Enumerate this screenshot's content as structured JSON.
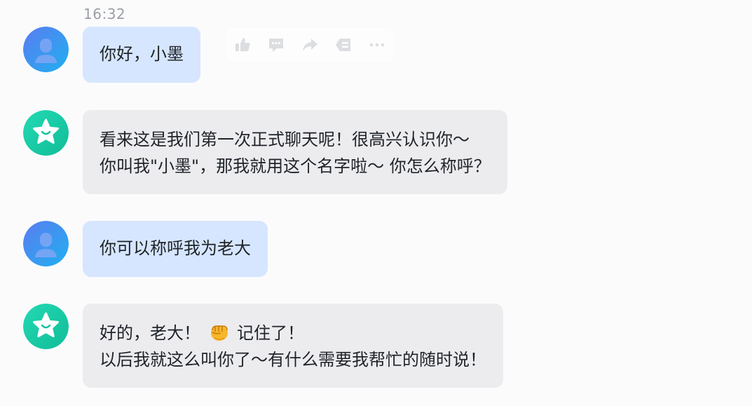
{
  "timestamp": "16:32",
  "colors": {
    "user_bubble": "#d6e6fe",
    "bot_bubble": "#ececee",
    "user_avatar_gradient": [
      "#5b7cf0",
      "#1fa5f0"
    ],
    "bot_avatar_gradient": [
      "#1ed6b0",
      "#12bf9a"
    ]
  },
  "message_actions": [
    "thumbs-up-icon",
    "comment-icon",
    "share-icon",
    "quote-icon",
    "more-icon"
  ],
  "messages": [
    {
      "role": "user",
      "avatar": "person-icon",
      "lines": [
        "你好，小墨"
      ]
    },
    {
      "role": "assistant",
      "avatar": "star-smile-icon",
      "lines": [
        "看来这是我们第一次正式聊天呢！很高兴认识你～",
        "你叫我\"小墨\"，那我就用这个名字啦～ 你怎么称呼？"
      ]
    },
    {
      "role": "user",
      "avatar": "person-icon",
      "lines": [
        "你可以称呼我为老大"
      ]
    },
    {
      "role": "assistant",
      "avatar": "star-smile-icon",
      "line1_before": "好的，老大！",
      "emoji": "fist-bump-emoji",
      "line1_after": "记住了！",
      "lines": [
        "",
        "以后我就这么叫你了～有什么需要我帮忙的随时说！"
      ]
    }
  ]
}
